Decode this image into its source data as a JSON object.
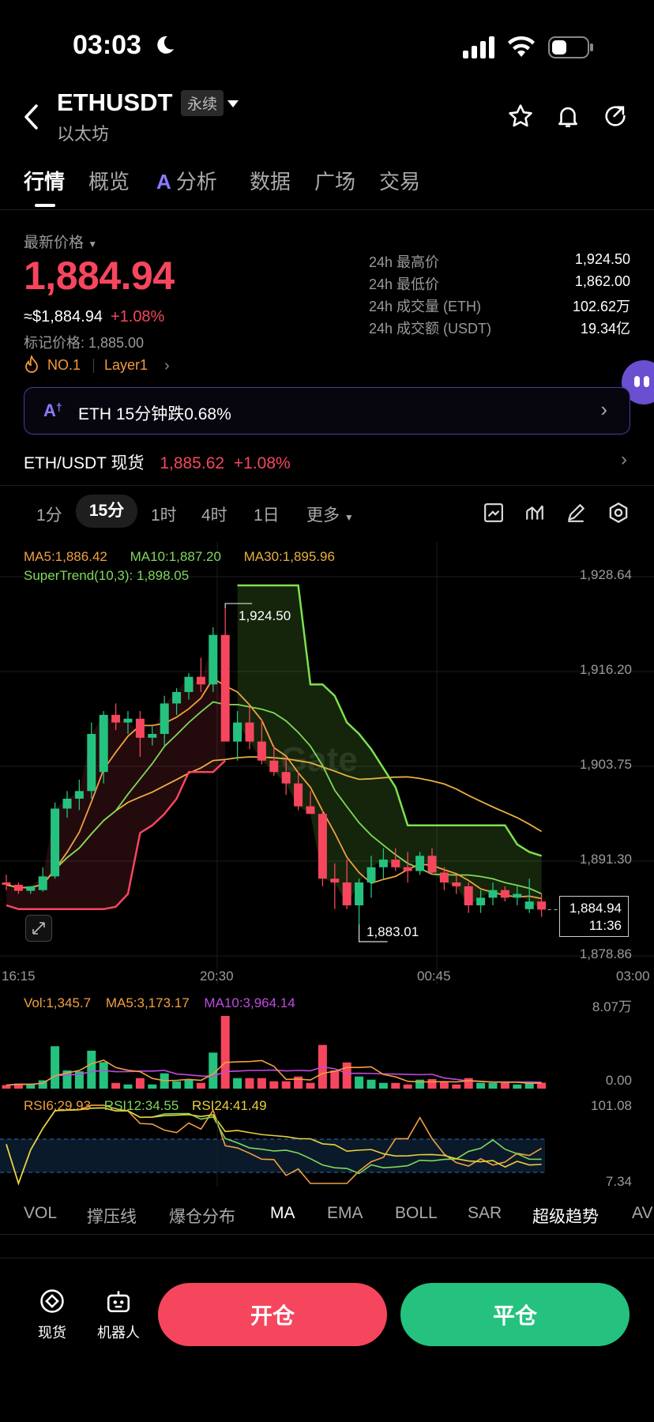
{
  "status": {
    "time": "03:03"
  },
  "header": {
    "symbol": "ETHUSDT",
    "tag": "永续",
    "subtitle": "以太坊"
  },
  "tabs": [
    "行情",
    "概览",
    "分析",
    "数据",
    "广场",
    "交易"
  ],
  "tab_ai_prefix": "A",
  "price": {
    "label": "最新价格",
    "last": "1,884.94",
    "usd": "≈$1,884.94",
    "change": "+1.08%",
    "mark": "标记价格: 1,885.00",
    "rank": "NO.1",
    "sector": "Layer1"
  },
  "stats": [
    {
      "label": "24h 最高价",
      "value": "1,924.50"
    },
    {
      "label": "24h 最低价",
      "value": "1,862.00"
    },
    {
      "label": "24h 成交量 (ETH)",
      "value": "102.62万"
    },
    {
      "label": "24h 成交额 (USDT)",
      "value": "19.34亿"
    }
  ],
  "ai_banner": {
    "text": "ETH 15分钟跌0.68%"
  },
  "spot": {
    "label": "ETH/USDT 现货",
    "price": "1,885.62",
    "change": "+1.08%"
  },
  "intervals": [
    "1分",
    "15分",
    "1时",
    "4时",
    "1日",
    "更多"
  ],
  "ma_legend": {
    "ma5": "MA5:1,886.42",
    "ma10": "MA10:1,887.20",
    "ma30": "MA30:1,895.96",
    "st": "SuperTrend(10,3): 1,898.05"
  },
  "high_label": "1,924.50",
  "low_label": "1,883.01",
  "current_tag": {
    "price": "1,884.94",
    "time": "11:36"
  },
  "vol_legend": {
    "vol": "Vol:1,345.7",
    "ma5": "MA5:3,173.17",
    "ma10": "MA10:3,964.14"
  },
  "rsi_legend": {
    "r6": "RSI6:29.93",
    "r12": "RSI12:34.55",
    "r24": "RSI24:41.49"
  },
  "indicators": [
    "VOL",
    "撑压线",
    "爆仓分布",
    "MA",
    "EMA",
    "BOLL",
    "SAR",
    "超级趋势",
    "AV"
  ],
  "bottom": {
    "spot": "现货",
    "bot": "机器人",
    "open": "开仓",
    "close": "平仓"
  },
  "watermark": "Gate",
  "colors": {
    "up": "#25c27f",
    "down": "#f6465d",
    "ma5": "#f0a040",
    "ma10": "#7fd85a",
    "ma30": "#e8b040",
    "supertrend_up": "#7ee04f",
    "supertrend_down": "#f6465d",
    "ma10_vol": "#c04ae0"
  },
  "chart_data": {
    "type": "candlestick",
    "x_ticks": [
      "16:15",
      "20:30",
      "00:45",
      "03:00"
    ],
    "y_ticks": [
      1928.64,
      1916.2,
      1903.75,
      1891.3,
      1878.86
    ],
    "ylim": [
      1878.86,
      1928.64
    ],
    "candles": [
      [
        1888.5,
        1889.5,
        1887.5,
        1888.2
      ],
      [
        1888.2,
        1888.5,
        1887.0,
        1887.4
      ],
      [
        1887.4,
        1888.0,
        1887.0,
        1888.0
      ],
      [
        1887.5,
        1890.5,
        1887.3,
        1889.3
      ],
      [
        1889.3,
        1899.0,
        1889.0,
        1898.2
      ],
      [
        1898.2,
        1900.5,
        1897.0,
        1899.5
      ],
      [
        1899.5,
        1902.0,
        1898.0,
        1900.5
      ],
      [
        1900.5,
        1909.5,
        1899.5,
        1908.0
      ],
      [
        1903.0,
        1911.0,
        1901.5,
        1910.5
      ],
      [
        1910.5,
        1912.0,
        1908.5,
        1909.5
      ],
      [
        1909.5,
        1911.0,
        1908.0,
        1910.0
      ],
      [
        1910.0,
        1911.0,
        1905.0,
        1907.5
      ],
      [
        1907.5,
        1909.0,
        1906.5,
        1908.0
      ],
      [
        1908.0,
        1913.0,
        1906.5,
        1912.0
      ],
      [
        1912.0,
        1914.0,
        1910.5,
        1913.5
      ],
      [
        1913.5,
        1916.0,
        1912.5,
        1915.5
      ],
      [
        1915.5,
        1918.0,
        1913.5,
        1914.5
      ],
      [
        1914.5,
        1922.0,
        1913.5,
        1921.0
      ],
      [
        1921.0,
        1924.5,
        1914.0,
        1907.0
      ],
      [
        1907.0,
        1911.0,
        1904.5,
        1909.5
      ],
      [
        1909.5,
        1911.5,
        1906.0,
        1907.0
      ],
      [
        1907.0,
        1910.0,
        1904.0,
        1904.5
      ],
      [
        1904.5,
        1906.5,
        1902.5,
        1903.0
      ],
      [
        1903.0,
        1905.0,
        1900.0,
        1901.5
      ],
      [
        1901.5,
        1903.0,
        1898.0,
        1898.5
      ],
      [
        1898.5,
        1900.5,
        1897.5,
        1897.5
      ],
      [
        1897.5,
        1898.0,
        1888.0,
        1889.0
      ],
      [
        1889.0,
        1891.0,
        1885.0,
        1888.5
      ],
      [
        1888.5,
        1891.5,
        1885.0,
        1885.5
      ],
      [
        1885.5,
        1889.0,
        1883.01,
        1888.5
      ],
      [
        1888.5,
        1892.0,
        1886.5,
        1890.5
      ],
      [
        1890.5,
        1893.0,
        1889.0,
        1891.5
      ],
      [
        1891.5,
        1893.0,
        1890.0,
        1890.5
      ],
      [
        1890.5,
        1892.5,
        1888.5,
        1890.0
      ],
      [
        1890.0,
        1892.5,
        1889.5,
        1892.0
      ],
      [
        1892.0,
        1893.0,
        1889.5,
        1889.8
      ],
      [
        1889.8,
        1890.5,
        1887.5,
        1888.5
      ],
      [
        1888.5,
        1889.5,
        1887.0,
        1888.0
      ],
      [
        1888.0,
        1888.5,
        1884.5,
        1885.5
      ],
      [
        1885.5,
        1887.5,
        1884.5,
        1886.5
      ],
      [
        1886.5,
        1888.5,
        1885.5,
        1887.5
      ],
      [
        1887.5,
        1888.0,
        1886.0,
        1886.5
      ],
      [
        1886.5,
        1888.0,
        1885.5,
        1887.0
      ],
      [
        1885.0,
        1889.0,
        1884.5,
        1886.0
      ],
      [
        1886.0,
        1887.0,
        1884.0,
        1884.94
      ]
    ]
  }
}
